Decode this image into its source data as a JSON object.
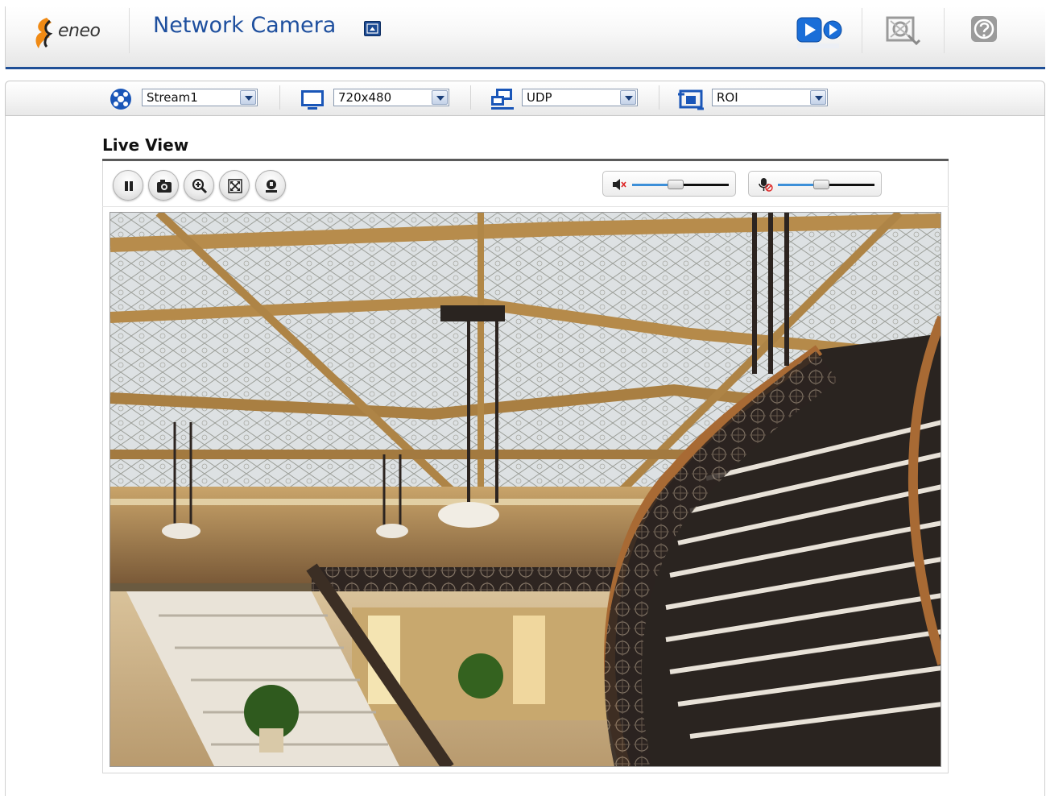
{
  "header": {
    "brand": "eneo",
    "title": "Network Camera",
    "icons": [
      "live-view-icon",
      "setup-icon",
      "help-icon"
    ],
    "accent_color": "#1e4f9e"
  },
  "toolbar": {
    "stream": {
      "icon": "stream-icon",
      "value": "Stream1"
    },
    "resolution": {
      "icon": "resolution-icon",
      "value": "720x480"
    },
    "protocol": {
      "icon": "protocol-icon",
      "value": "UDP"
    },
    "roi": {
      "icon": "roi-icon",
      "value": "ROI"
    }
  },
  "live_view": {
    "heading": "Live View",
    "controls": [
      "pause-icon",
      "snapshot-icon",
      "zoom-icon",
      "fullscreen-icon",
      "record-icon"
    ],
    "speaker_volume": 0.45,
    "microphone_volume": 0.45
  },
  "video": {
    "scene": "camera-feed",
    "colors": {
      "skylight": "#d9dde0",
      "gold": "#b08a4a",
      "stair": "#2a2420",
      "rail": "#a86a34"
    }
  }
}
